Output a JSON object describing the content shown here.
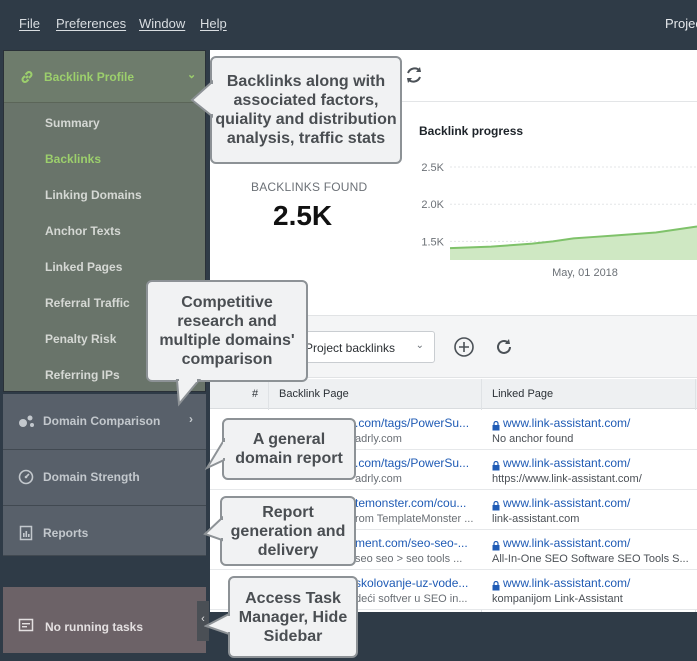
{
  "menubar": {
    "items": [
      "File",
      "Preferences",
      "Window",
      "Help"
    ],
    "project_title": "Projec"
  },
  "sidebar": {
    "section": {
      "label": "Backlink Profile",
      "icon": "link-icon",
      "expanded": true
    },
    "items": [
      "Summary",
      "Backlinks",
      "Linking Domains",
      "Anchor Texts",
      "Linked Pages",
      "Referral Traffic",
      "Penalty Risk",
      "Referring IPs"
    ],
    "active_item": "Backlinks",
    "blocks": [
      {
        "label": "Domain Comparison",
        "icon": "domain-comparison-icon"
      },
      {
        "label": "Domain Strength",
        "icon": "gauge-icon"
      },
      {
        "label": "Reports",
        "icon": "reports-icon"
      }
    ],
    "tasks": {
      "label": "No running tasks",
      "icon": "tasks-icon"
    }
  },
  "stats": {
    "found_label": "BACKLINKS FOUND",
    "found_value": "2.5K"
  },
  "chart_data": {
    "type": "area",
    "title": "Backlink progress",
    "y_ticks": [
      "2.5K",
      "2.0K",
      "1.5K"
    ],
    "x_ticks": [
      "May, 01 2018"
    ],
    "ylim": [
      1250,
      2500
    ],
    "x": [
      0,
      1,
      2,
      3,
      4,
      5,
      6,
      7,
      8,
      9,
      10,
      11,
      12
    ],
    "values": [
      1410,
      1420,
      1430,
      1450,
      1470,
      1500,
      1540,
      1560,
      1580,
      1600,
      1620,
      1660,
      1700
    ]
  },
  "filter": {
    "select_value": "Project backlinks"
  },
  "table": {
    "columns": [
      "#",
      "Backlink Page",
      "Linked Page"
    ],
    "rows": [
      {
        "page": ".com/tags/PowerSu...",
        "page_sub": "adrly.com",
        "linked": "www.link-assistant.com/",
        "linked_sub": "No anchor found"
      },
      {
        "page": ".com/tags/PowerSu...",
        "page_sub": "adrly.com",
        "linked": "www.link-assistant.com/",
        "linked_sub": "https://www.link-assistant.com/"
      },
      {
        "page": "temonster.com/cou...",
        "page_sub": "rom TemplateMonster ...",
        "linked": "www.link-assistant.com/",
        "linked_sub": "link-assistant.com"
      },
      {
        "page": "ment.com/seo-seo-...",
        "page_sub": "seo seo > seo tools ...",
        "linked": "www.link-assistant.com/",
        "linked_sub": "All-In-One SEO Software SEO Tools S..."
      },
      {
        "page": "skolovanje-uz-vode...",
        "page_sub": "deći softver u SEO in...",
        "linked": "www.link-assistant.com/",
        "linked_sub": "kompanijom Link-Assistant"
      }
    ]
  },
  "callouts": {
    "backlinks": "Backlinks along with associated factors, quiality and distribution analysis, traffic stats",
    "competitive": "Competitive research and multiple domains' comparison",
    "domain_report": "A general domain report",
    "reports": "Report generation and delivery",
    "task_manager": "Access Task Manager, Hide Sidebar"
  },
  "colors": {
    "accent_green": "#9ccf6c",
    "link_blue": "#1f5bb5",
    "chart_line": "#7fc26a",
    "chart_fill": "#cfe8c3"
  }
}
